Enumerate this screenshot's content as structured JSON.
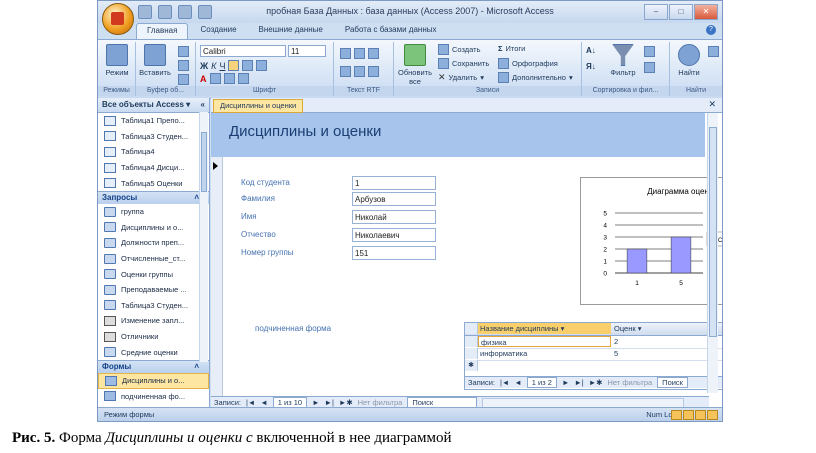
{
  "window": {
    "title": "пробная База Данных : база данных (Access 2007) - Microsoft Access",
    "controls": [
      "‒",
      "□",
      "✕"
    ]
  },
  "ribbon": {
    "tabs": [
      "Главная",
      "Создание",
      "Внешние данные",
      "Работа с базами данных"
    ],
    "active_tab": "Главная",
    "groups": {
      "views": {
        "label": "Режимы",
        "button": "Режим"
      },
      "clipboard": {
        "label": "Буфер об...",
        "button": "Вставить"
      },
      "font": {
        "label": "Шрифт",
        "font_name": "Calibri",
        "font_size": "11"
      },
      "rich_text": {
        "label": "Текст RTF"
      },
      "records": {
        "label": "Записи",
        "refresh": "Обновить все",
        "create": "Создать",
        "save": "Сохранить",
        "delete": "Удалить",
        "totals": "Итоги",
        "spelling": "Орфография",
        "more": "Дополнительно"
      },
      "sort_filter": {
        "label": "Сортировка и фил...",
        "filter": "Фильтр"
      },
      "find": {
        "label": "Найти",
        "button": "Найти"
      }
    }
  },
  "nav_pane": {
    "header": "Все объекты Access",
    "tables": [
      "Таблица1 Препо...",
      "Таблица3 Студен...",
      "Таблица4",
      "Таблица4 Дисци...",
      "Таблица5 Оценки"
    ],
    "queries_title": "Запросы",
    "queries": [
      "группа",
      "Дисциплины и о...",
      "Должности преп...",
      "Отчисленные_ст...",
      "Оценки группы",
      "Преподаваемые ...",
      "Таблица3 Студен..."
    ],
    "reports": [
      "Изменение запл...",
      "Отличники",
      "Средние оценки"
    ],
    "forms_title": "Формы",
    "forms": [
      "Дисциплины и о...",
      "подчиненная фо..."
    ]
  },
  "document": {
    "tab": "Дисциплины и оценки",
    "form_title": "Дисциплины и оценки",
    "fields": [
      {
        "label": "Код студента",
        "value": "1"
      },
      {
        "label": "Фамилия",
        "value": "Арбузов"
      },
      {
        "label": "Имя",
        "value": "Николай"
      },
      {
        "label": "Отчество",
        "value": "Николаевич"
      },
      {
        "label": "Номер группы",
        "value": "151"
      }
    ],
    "subform_label": "подчиненная форма",
    "subform": {
      "headers": [
        "Название дисциплины",
        "Оценк"
      ],
      "rows": [
        [
          "физика",
          "2"
        ],
        [
          "информатика",
          "5"
        ]
      ],
      "nav": {
        "label": "Записи:",
        "position": "1 из 2",
        "filter": "Нет фильтра",
        "search": "Поиск"
      }
    },
    "record_nav": {
      "label": "Записи:",
      "position": "1 из 10",
      "filter": "Нет фильтра",
      "search": "Поиск"
    }
  },
  "chart_data": {
    "type": "bar",
    "title": "Диаграмма оценок",
    "categories": [
      "1",
      "5"
    ],
    "values": [
      2,
      3
    ],
    "series": [
      {
        "name": "Сумма_Оценки",
        "values": [
          2,
          3
        ]
      }
    ],
    "yticks": [
      "0",
      "1",
      "2",
      "3",
      "4",
      "5"
    ],
    "ylim": [
      0,
      5
    ],
    "legend": "right",
    "bar_color": "#9999ff"
  },
  "status": {
    "left": "Режим формы",
    "right": "Num Lock"
  },
  "caption": {
    "fig": "Рис. 5.",
    "text1": "Форма",
    "italic": "Дисциплины и оценки с",
    "text2": "включенной в нее диаграммой"
  }
}
